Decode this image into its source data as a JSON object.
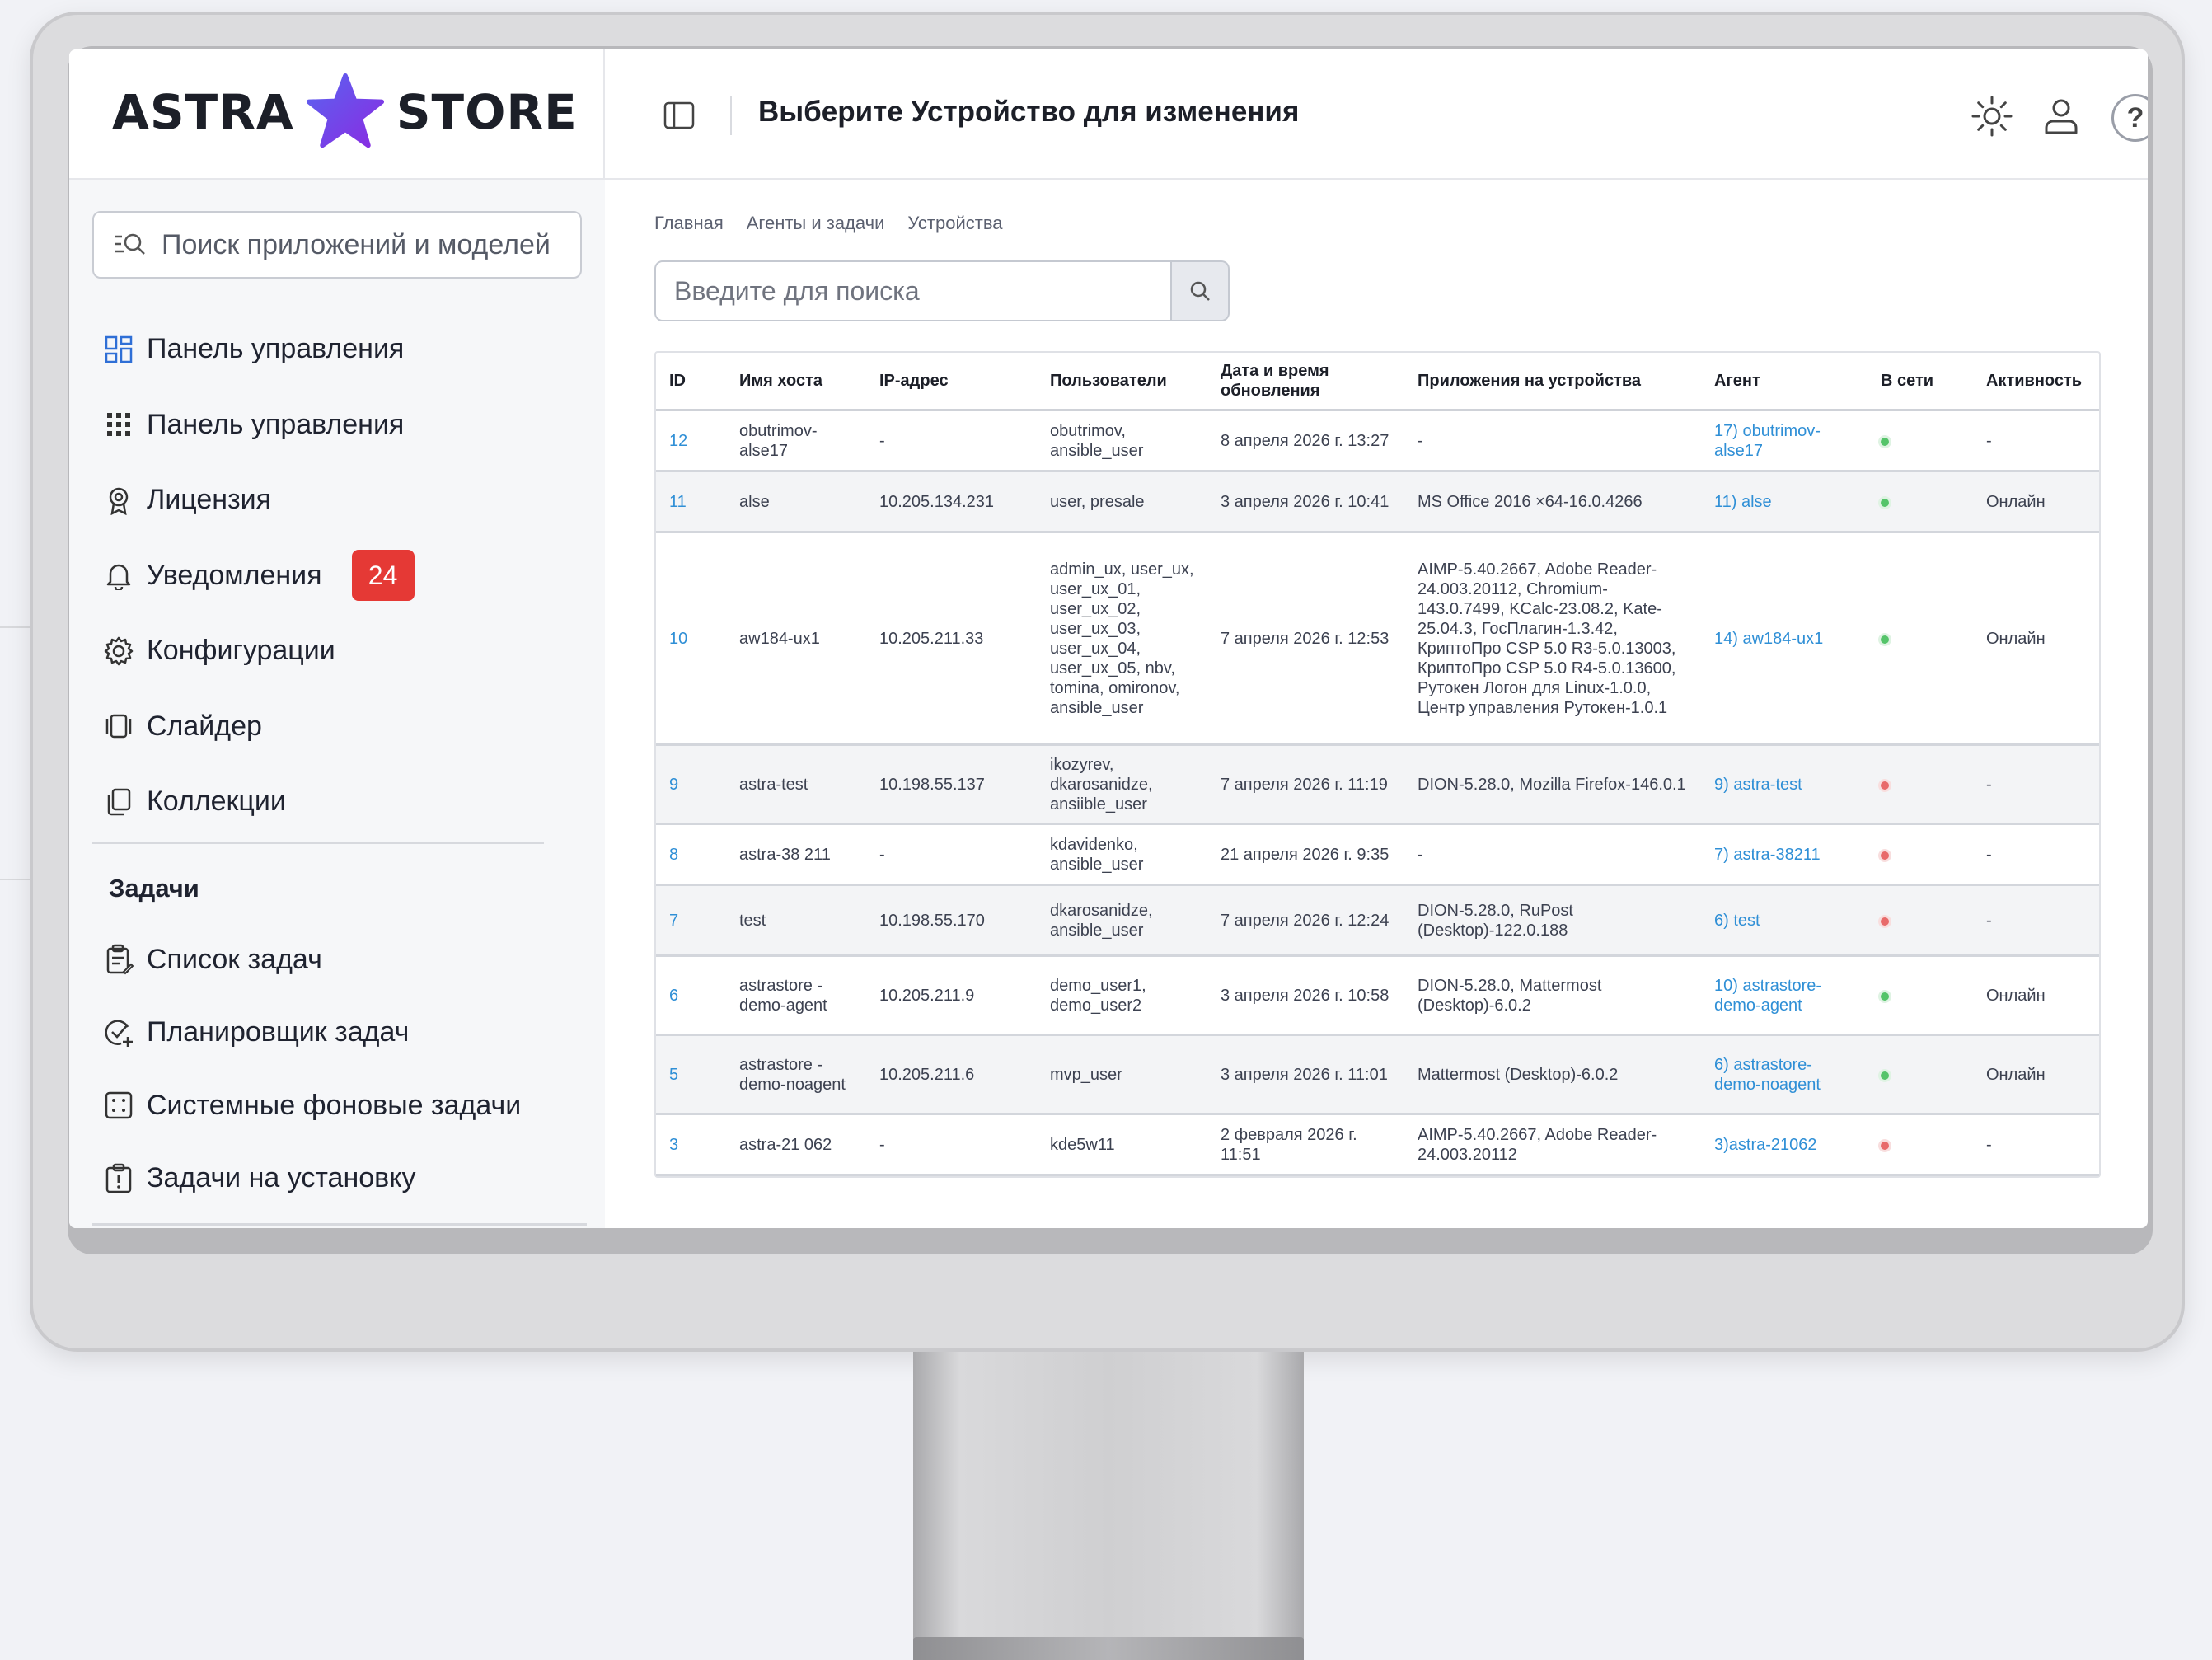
{
  "brand": {
    "left": "ASTRA",
    "right": "STORE",
    "star_color": "#7b3fe4"
  },
  "header": {
    "page_title": "Выберите Устройство для изменения",
    "toggle_icon": "sidebar-toggle-icon",
    "icons": [
      "sun-icon",
      "user-icon",
      "help-icon"
    ],
    "help_symbol": "?"
  },
  "sidebar": {
    "search_placeholder": "Поиск приложений и моделей",
    "items": [
      {
        "label": "Панель управления",
        "icon": "dashboard-icon"
      },
      {
        "label": "Панель управления",
        "icon": "grid-dots-icon"
      },
      {
        "label": "Лицензия",
        "icon": "license-icon"
      },
      {
        "label": "Уведомления",
        "icon": "bell-icon",
        "badge": "24"
      },
      {
        "label": "Конфигурации",
        "icon": "gear-icon"
      },
      {
        "label": "Слайдер",
        "icon": "slider-icon"
      },
      {
        "label": "Коллекции",
        "icon": "collections-icon"
      }
    ],
    "tasks_heading": "Задачи",
    "tasks": [
      {
        "label": "Список задач",
        "icon": "clipboard-icon"
      },
      {
        "label": "Планировщик задач",
        "icon": "scheduler-icon"
      },
      {
        "label": "Системные фоновые задачи",
        "icon": "background-tasks-icon"
      },
      {
        "label": "Задачи на установку",
        "icon": "install-tasks-icon"
      }
    ],
    "badge_color": "#e53935"
  },
  "breadcrumb": [
    "Главная",
    "Агенты и задачи",
    "Устройства"
  ],
  "search": {
    "placeholder": "Введите для поиска"
  },
  "table": {
    "columns": [
      "ID",
      "Имя хоста",
      "IP-адрес",
      "Пользователи",
      "Дата и время обновления",
      "Приложения на устройства",
      "Агент",
      "В сети",
      "Активность"
    ],
    "rows": [
      {
        "id": "12",
        "host": "obutrimov-alse17",
        "ip": "-",
        "users": "obutrimov, ansible_user",
        "date": "8 апреля 2026 г. 13:27",
        "apps": "-",
        "agent": "17) obutrimov-alse17",
        "online": "green",
        "activity": "-"
      },
      {
        "id": "11",
        "host": "alse",
        "ip": "10.205.134.231",
        "users": "user, presale",
        "date": "3 апреля 2026 г. 10:41",
        "apps": "MS Office 2016 ×64-16.0.4266",
        "agent": "11) alse",
        "online": "green",
        "activity": "Онлайн"
      },
      {
        "id": "10",
        "host": "aw184-ux1",
        "ip": "10.205.211.33",
        "users": "admin_ux, user_ux, user_ux_01, user_ux_02, user_ux_03, user_ux_04, user_ux_05, nbv, tomina, omironov, ansible_user",
        "date": "7 апреля 2026 г. 12:53",
        "apps": "AIMP-5.40.2667, Adobe Reader-24.003.20112, Chromium-143.0.7499, KCalc-23.08.2, Kate-25.04.3, ГосПлагин-1.3.42, КриптоПро CSP 5.0 R3-5.0.13003, КриптоПро CSP 5.0 R4-5.0.13600, Рутокен Логон для Linux-1.0.0, Центр управления Рутокен-1.0.1",
        "agent": "14) aw184-ux1",
        "online": "green",
        "activity": "Онлайн"
      },
      {
        "id": "9",
        "host": "astra-test",
        "ip": "10.198.55.137",
        "users": "ikozyrev, dkarosanidze, ansiible_user",
        "date": "7 апреля 2026 г. 11:19",
        "apps": "DION-5.28.0, Mozilla Firefox-146.0.1",
        "agent": "9) astra-test",
        "online": "red",
        "activity": "-"
      },
      {
        "id": "8",
        "host": "astra-38 211",
        "ip": "-",
        "users": "kdavidenko, ansible_user",
        "date": "21 апреля 2026 г. 9:35",
        "apps": "-",
        "agent": "7) astra-38211",
        "online": "red",
        "activity": "-"
      },
      {
        "id": "7",
        "host": "test",
        "ip": "10.198.55.170",
        "users": "dkarosanidze, ansible_user",
        "date": "7 апреля 2026 г. 12:24",
        "apps": "DION-5.28.0, RuPost (Desktop)-122.0.188",
        "agent": "6) test",
        "online": "red",
        "activity": "-"
      },
      {
        "id": "6",
        "host": "astrastore -demo-agent",
        "ip": "10.205.211.9",
        "users": "demo_user1, demo_user2",
        "date": "3 апреля 2026 г. 10:58",
        "apps": "DION-5.28.0, Mattermost (Desktop)-6.0.2",
        "agent": "10) astrastore-demo-agent",
        "online": "green",
        "activity": "Онлайн"
      },
      {
        "id": "5",
        "host": "astrastore -demo-noagent",
        "ip": "10.205.211.6",
        "users": "mvp_user",
        "date": "3 апреля 2026 г. 11:01",
        "apps": "Mattermost (Desktop)-6.0.2",
        "agent": "6) astrastore-demo-noagent",
        "online": "green",
        "activity": "Онлайн"
      },
      {
        "id": "3",
        "host": "astra-21 062",
        "ip": "-",
        "users": "kde5w11",
        "date": "2 февраля 2026 г. 11:51",
        "apps": "AIMP-5.40.2667, Adobe Reader-24.003.20112",
        "agent": "3)astra-21062",
        "online": "red",
        "activity": "-"
      }
    ]
  },
  "colors": {
    "link": "#2f8fd6",
    "online": "#55c46a",
    "offline": "#e86a6a"
  }
}
